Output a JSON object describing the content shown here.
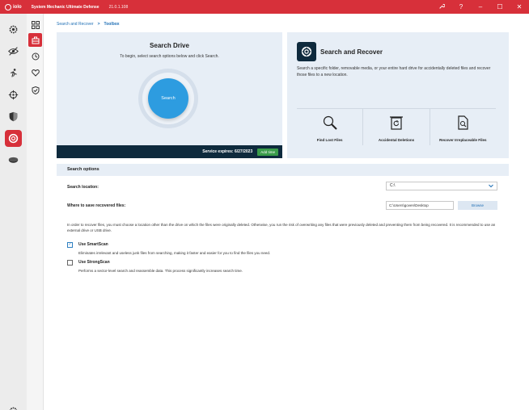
{
  "app": {
    "logo_text": "iolo",
    "title": "System Mechanic Ultimate Defense",
    "version": "21.0.1.108"
  },
  "titlebar_icons": [
    "wrench-icon",
    "help-icon",
    "minimize-icon",
    "maximize-icon",
    "close-icon"
  ],
  "titlebar_glyphs": {
    "help": "?",
    "minimize": "–",
    "maximize": "☐",
    "close": "✕"
  },
  "breadcrumb": {
    "parent": "Search and Recover",
    "separator": ">",
    "current": "Toolbox"
  },
  "search_card": {
    "title": "Search Drive",
    "subtitle": "To begin, select search options below and click Search.",
    "button": "Search",
    "expires": "Service expires: 6/27/2023",
    "add_time": "Add time"
  },
  "recover_card": {
    "title": "Search and Recover",
    "description": "Search a specific folder, removable media, or your entire hard drive for accidentally deleted files and recover those files to a new location.",
    "features": [
      {
        "label": "Find Lost Files",
        "icon": "magnifier-icon"
      },
      {
        "label": "Accidental Deletions",
        "icon": "trash-restore-icon"
      },
      {
        "label": "Recover Irreplaceable Files",
        "icon": "document-search-icon"
      }
    ]
  },
  "options": {
    "header": "Search options",
    "location_label": "Search location:",
    "location_value": "C:\\",
    "save_label": "Where to save recovered files:",
    "save_value": "C:\\Users\\goven\\Desktop",
    "browse": "Browse",
    "info": "In order to recover files, you must choose a location other than the drive on which the files were originally deleted. Otherwise, you run the risk of overwriting any files that were previously deleted and preventing them from being recovered. It is recommended to use an external drive or USB drive.",
    "smartscan": {
      "checked": true,
      "check_glyph": "✓",
      "title": "Use SmartScan",
      "desc": "Eliminates irrelevant and useless junk files from searching, making it faster and easier for you to find the files you need."
    },
    "strongscan": {
      "checked": false,
      "title": "Use StrongScan",
      "desc": "Performs a sector-level search and reassemble data. This process significantly increases search time."
    }
  },
  "colors": {
    "accent": "#d7303a",
    "primary": "#2d9ce0",
    "panel": "#e7eef6",
    "dark": "#0e2a3d",
    "green": "#3a9c4a"
  }
}
